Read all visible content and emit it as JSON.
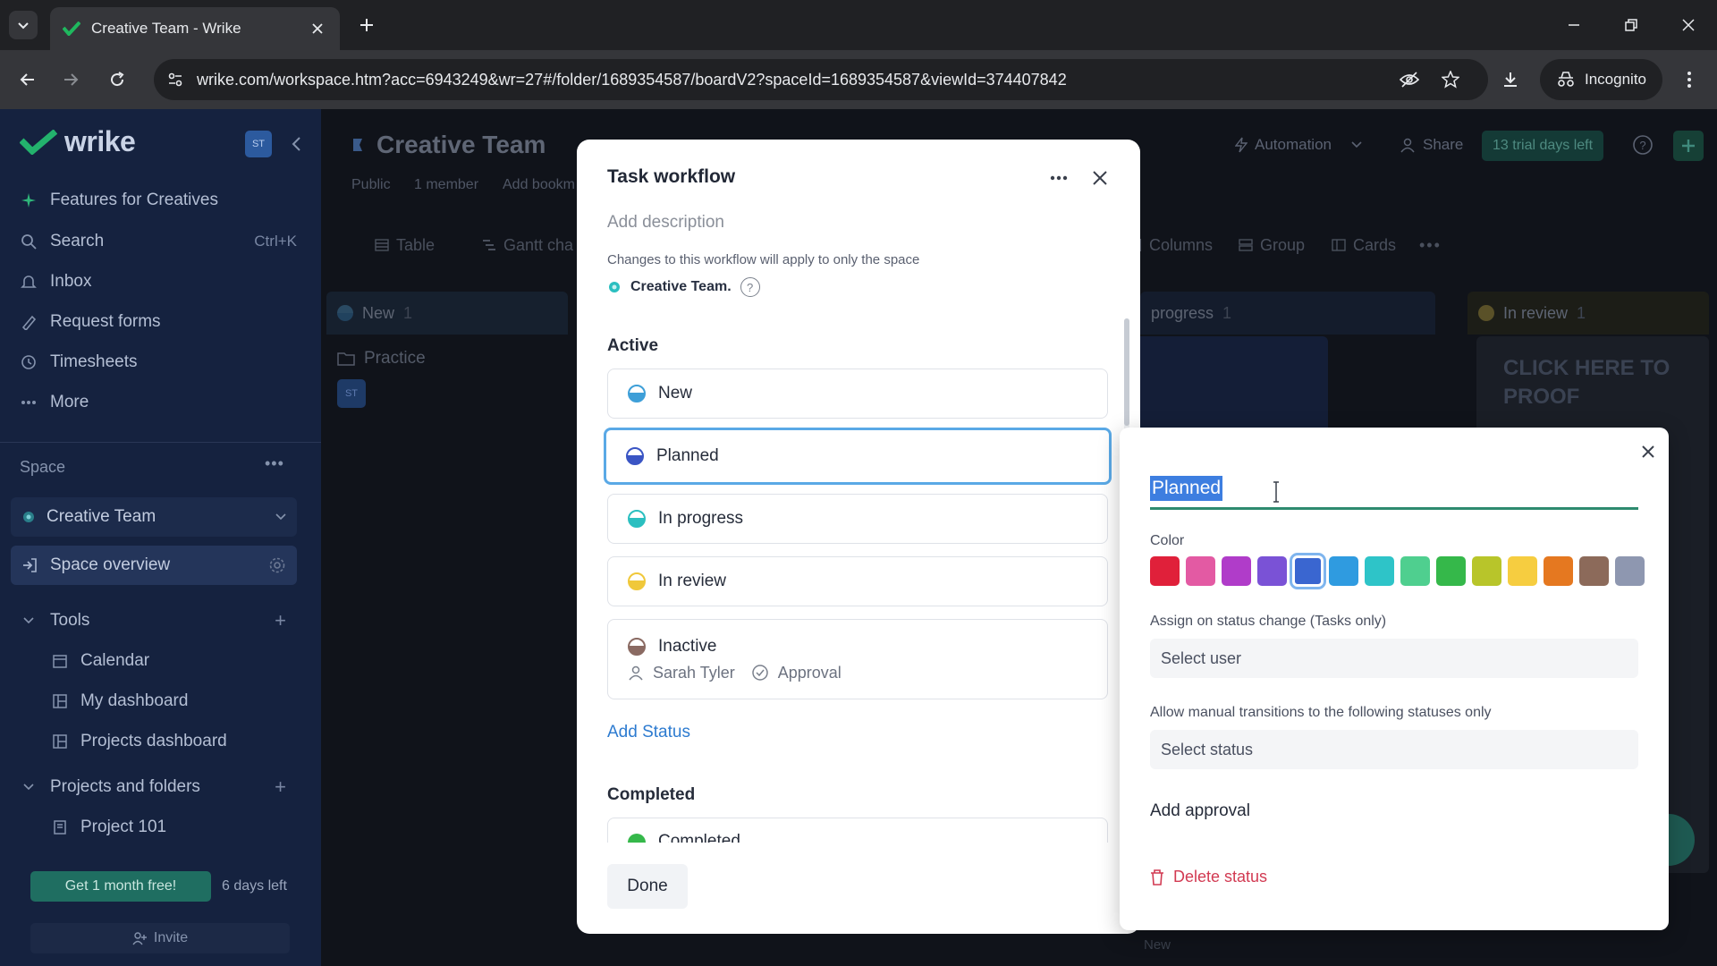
{
  "browser": {
    "tab_title": "Creative Team - Wrike",
    "url": "wrike.com/workspace.htm?acc=6943249&wr=27#/folder/1689354587/boardV2?spaceId=1689354587&viewId=374407842",
    "incognito_label": "Incognito"
  },
  "sidebar": {
    "logo": "wrike",
    "avatar": "ST",
    "items": [
      {
        "label": "Features for Creatives",
        "icon": "sparkle-icon"
      },
      {
        "label": "Search",
        "icon": "search-icon",
        "shortcut": "Ctrl+K"
      },
      {
        "label": "Inbox",
        "icon": "bell-icon"
      },
      {
        "label": "Request forms",
        "icon": "form-icon"
      },
      {
        "label": "Timesheets",
        "icon": "clock-icon"
      },
      {
        "label": "More",
        "icon": "more-icon"
      }
    ],
    "space_label": "Space",
    "space_name": "Creative Team",
    "space_overview": "Space overview",
    "tools_label": "Tools",
    "tools": [
      "Calendar",
      "My dashboard",
      "Projects dashboard"
    ],
    "projects_label": "Projects and folders",
    "projects": [
      "Project 101"
    ],
    "get_free": "Get 1 month free!",
    "days_left": "6 days left",
    "invite": "Invite"
  },
  "main": {
    "title": "Creative Team",
    "meta": [
      "Public",
      "1 member",
      "Add bookm"
    ],
    "automation": "Automation",
    "share": "Share",
    "trial": "13 trial days left",
    "views": [
      "Table",
      "Gantt cha"
    ],
    "view_options": [
      "Columns",
      "Group",
      "Cards"
    ],
    "columns": [
      {
        "name": "New",
        "count": "1"
      },
      {
        "name": "progress",
        "count": "1"
      },
      {
        "name": "In review",
        "count": "1"
      }
    ],
    "card_title": "Practice",
    "card_avatar": "ST",
    "proof_text": "CLICK HERE TO PROOF",
    "bottom_label": "New"
  },
  "modal": {
    "title": "Task workflow",
    "description_placeholder": "Add description",
    "note": "Changes to this workflow will apply to only the space",
    "space": "Creative Team.",
    "active_label": "Active",
    "statuses": [
      {
        "name": "New",
        "color": "#3e9fd8"
      },
      {
        "name": "Planned",
        "color": "#3a55c4"
      },
      {
        "name": "In progress",
        "color": "#2bbfc0"
      },
      {
        "name": "In review",
        "color": "#f0c83a"
      },
      {
        "name": "Inactive",
        "color": "#8a6a62",
        "assignee": "Sarah Tyler",
        "approval": "Approval"
      }
    ],
    "add_status": "Add Status",
    "completed_label": "Completed",
    "completed_first": "Completed",
    "done": "Done"
  },
  "editor": {
    "name_value": "Planned",
    "color_label": "Color",
    "colors": [
      "#e0203a",
      "#e35aa3",
      "#b03cc9",
      "#7a52d6",
      "#3a66d0",
      "#2f9be0",
      "#2ec4c8",
      "#4fcf8f",
      "#35b84a",
      "#b8c52a",
      "#f6cd40",
      "#e57820",
      "#8c6a5a",
      "#8e97b0"
    ],
    "selected_color": "#3a66d0",
    "assign_label": "Assign on status change (Tasks only)",
    "assign_placeholder": "Select user",
    "transitions_label": "Allow manual transitions to the following statuses only",
    "transitions_placeholder": "Select status",
    "add_approval": "Add approval",
    "delete": "Delete status"
  }
}
